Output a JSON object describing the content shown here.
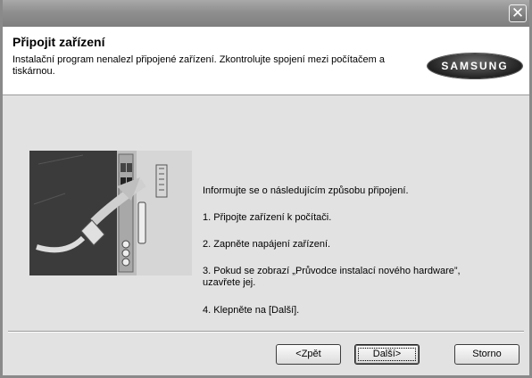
{
  "window": {
    "close_glyph": "✕"
  },
  "header": {
    "title": "Připojit zařízení",
    "subtitle": "Instalační program nenalezl připojené zařízení. Zkontrolujte spojení mezi počítačem a tiskárnou.",
    "logo_text": "SAMSUNG"
  },
  "main": {
    "illustration_icon": "usb-cable-connecting-to-computer-illustration",
    "intro": "Informujte se o následujícím způsobu připojení.",
    "steps": [
      "1. Připojte zařízení k počítači.",
      "2. Zapněte napájení zařízení.",
      "3. Pokud se zobrazí „Průvodce instalací nového hardware”,",
      "uzavřete jej.",
      "4. Klepněte na [Další]."
    ]
  },
  "buttons": {
    "back": "<Zpět",
    "next": "Další>",
    "cancel": "Storno"
  }
}
